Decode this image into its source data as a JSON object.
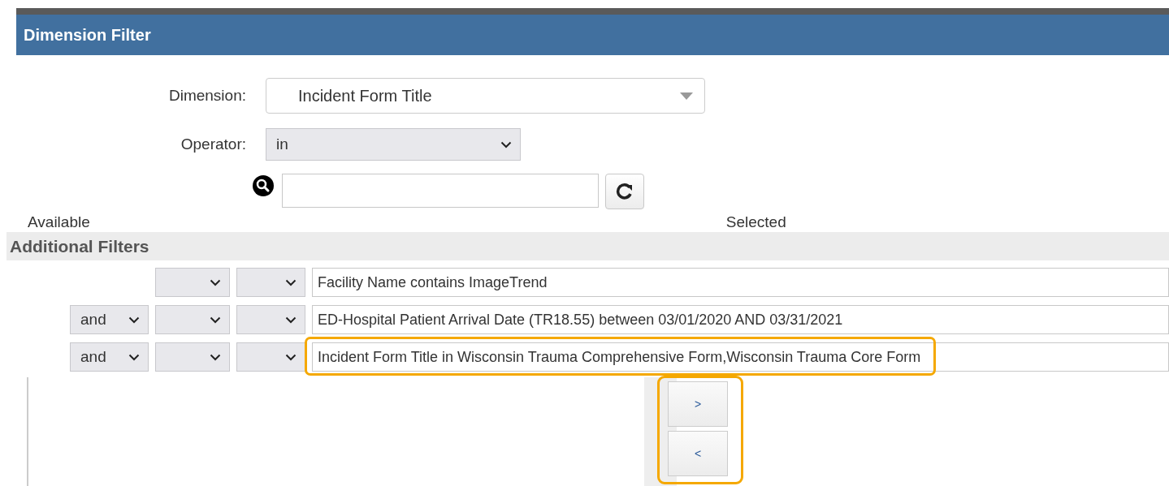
{
  "header": {
    "title": "Dimension Filter"
  },
  "dimension": {
    "label": "Dimension:",
    "value": "Incident Form Title"
  },
  "operator": {
    "label": "Operator:",
    "value": "in"
  },
  "lists": {
    "available_label": "Available",
    "selected_label": "Selected"
  },
  "additional_filters": {
    "title": "Additional Filters",
    "rows": [
      {
        "conjunction": null,
        "expression": "Facility Name contains ImageTrend",
        "highlighted": false
      },
      {
        "conjunction": "and",
        "expression": "ED-Hospital Patient Arrival Date (TR18.55) between 03/01/2020 AND 03/31/2021",
        "highlighted": false
      },
      {
        "conjunction": "and",
        "expression": "Incident Form Title in Wisconsin Trauma Comprehensive Form,Wisconsin Trauma Core Form",
        "highlighted": true
      }
    ]
  },
  "move_buttons": {
    "add": ">",
    "remove": "<",
    "highlighted": true
  }
}
